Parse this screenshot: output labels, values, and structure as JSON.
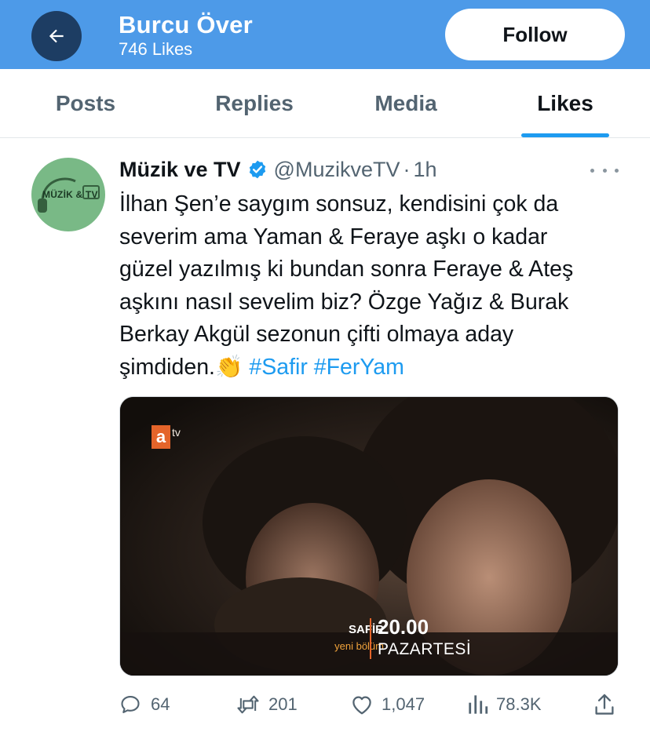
{
  "header": {
    "title": "Burcu Över",
    "subtitle": "746 Likes",
    "follow_label": "Follow",
    "back_icon": "arrow-left-icon"
  },
  "tabs": [
    {
      "label": "Posts",
      "active": false
    },
    {
      "label": "Replies",
      "active": false
    },
    {
      "label": "Media",
      "active": false
    },
    {
      "label": "Likes",
      "active": true
    }
  ],
  "tweet": {
    "author_name": "Müzik ve TV",
    "verified": true,
    "handle": "@MuzikveTV",
    "separator": "·",
    "time": "1h",
    "avatar_text": "MÜZİK & TV",
    "text_lines": [
      "İlhan Şen’e saygım sonsuz, kendisini çok da",
      "severim ama Yaman & Feraye aşkı o kadar",
      "güzel yazılmış ki bundan sonra Feraye & Ateş",
      "aşkını nasıl sevelim biz? Özge Yağız & Burak",
      "Berkay Akgül sezonun çifti olmaya aday"
    ],
    "last_line_text": "şimdiden.",
    "emoji": "👏",
    "hashtags": [
      "#Safir",
      "#FerYam"
    ],
    "media": {
      "channel_logo": "a",
      "channel_suffix": "tv",
      "show_name": "SAFİR",
      "episode_label": "yeni bölüm",
      "air_time": "20.00",
      "air_day": "PAZARTESİ"
    },
    "stats": {
      "replies": "64",
      "retweets": "201",
      "likes": "1,047",
      "views": "78.3K"
    }
  },
  "colors": {
    "header_bg": "#4d9ae8",
    "back_button_bg": "#1d3d63",
    "accent": "#1d9bf0",
    "muted_text": "#536471"
  }
}
